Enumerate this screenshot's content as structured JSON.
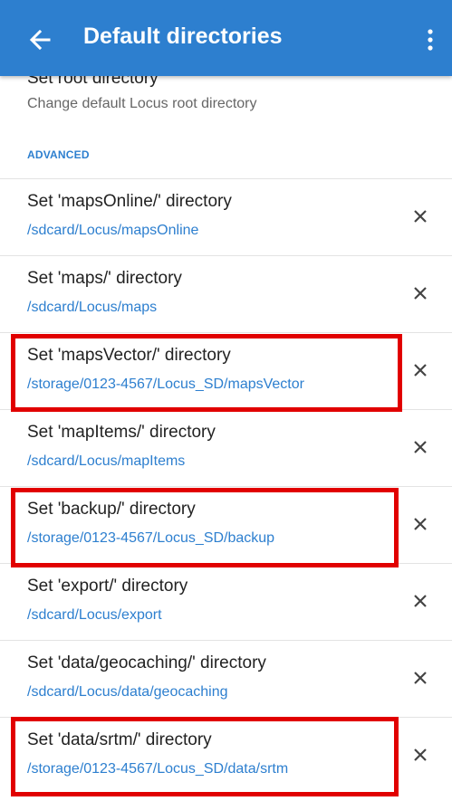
{
  "appbar": {
    "title": "Default directories",
    "back_icon": "arrow-left-icon",
    "more_icon": "more-vertical-icon",
    "color": "#2d7fcf"
  },
  "root_item": {
    "title": "Set root directory",
    "subtitle": "Change default Locus root directory"
  },
  "section": {
    "header": "ADVANCED"
  },
  "items": [
    {
      "title": "Set 'mapsOnline/' directory",
      "path": "/sdcard/Locus/mapsOnline"
    },
    {
      "title": "Set 'maps/' directory",
      "path": "/sdcard/Locus/maps"
    },
    {
      "title": "Set 'mapsVector/' directory",
      "path": "/storage/0123-4567/Locus_SD/mapsVector"
    },
    {
      "title": "Set 'mapItems/' directory",
      "path": "/sdcard/Locus/mapItems"
    },
    {
      "title": "Set 'backup/' directory",
      "path": "/storage/0123-4567/Locus_SD/backup"
    },
    {
      "title": "Set 'export/' directory",
      "path": "/sdcard/Locus/export"
    },
    {
      "title": "Set 'data/geocaching/' directory",
      "path": "/sdcard/Locus/data/geocaching"
    },
    {
      "title": "Set 'data/srtm/' directory",
      "path": "/storage/0123-4567/Locus_SD/data/srtm"
    }
  ],
  "clear_icon": "close-icon",
  "highlight_color": "#e10000"
}
